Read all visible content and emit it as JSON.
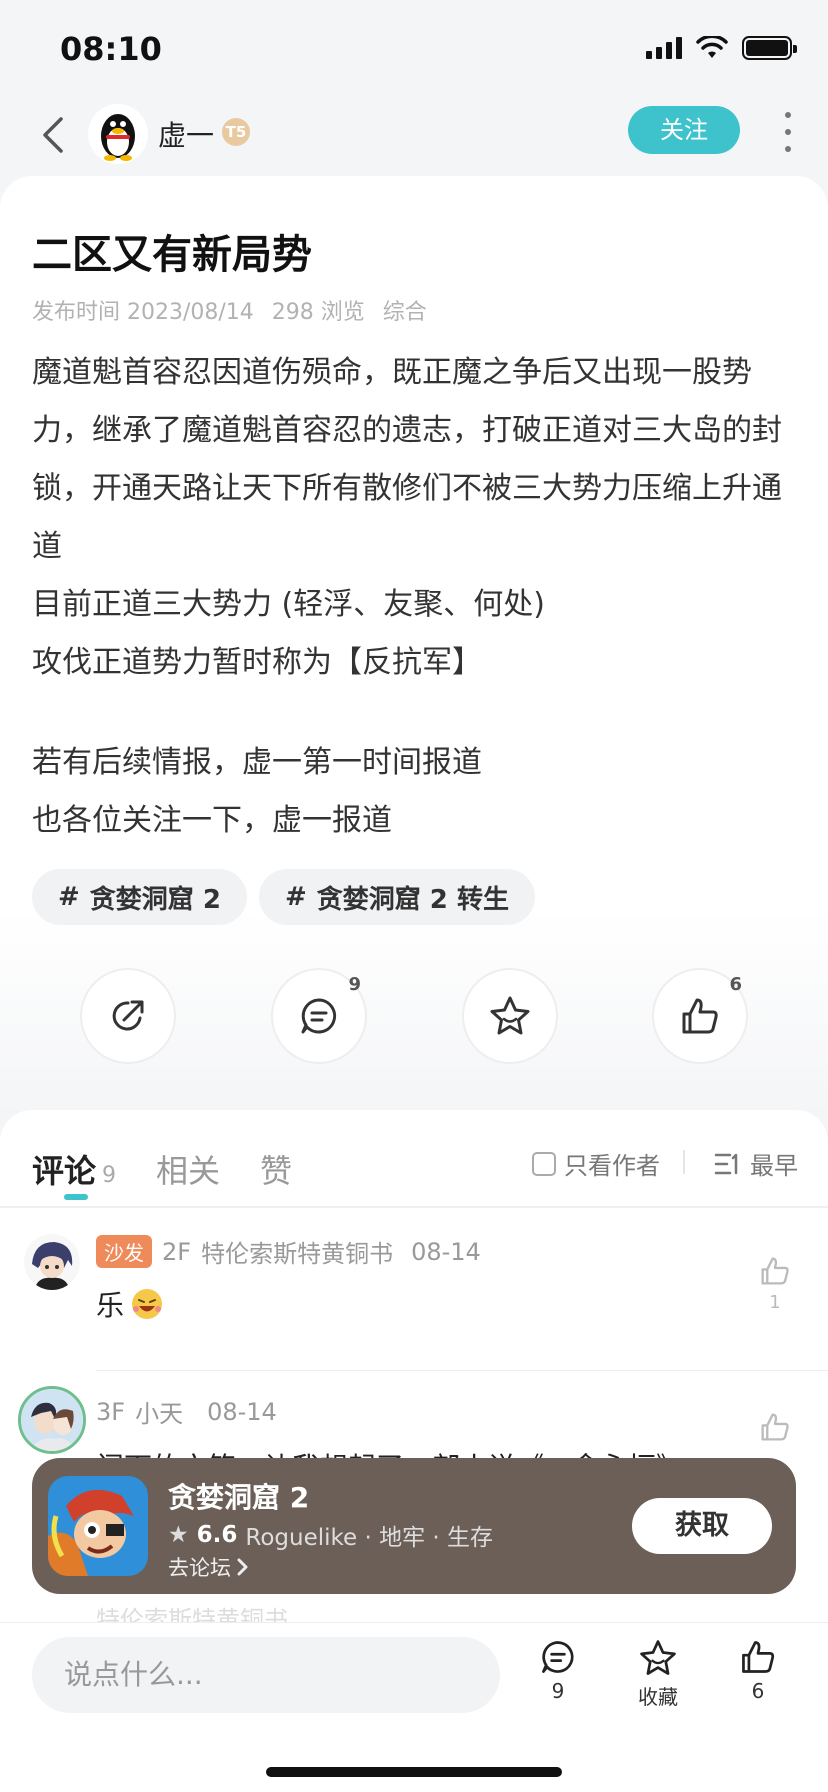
{
  "status_bar": {
    "time": "08:10"
  },
  "nav": {
    "username": "虚一",
    "level": "T5",
    "follow_label": "关注"
  },
  "post": {
    "title": "二区又有新局势",
    "meta": {
      "publish": "发布时间 2023/08/14",
      "views": "298 浏览",
      "category": "综合"
    },
    "paragraphs": [
      "魔道魁首容忍因道伤殒命，既正魔之争后又出现一股势力，继承了魔道魁首容忍的遗志，打破正道对三大岛的封锁，开通天路让天下所有散修们不被三大势力压缩上升通道",
      "目前正道三大势力 (轻浮、友聚、何处)",
      "攻伐正道势力暂时称为【反抗军】",
      "若有后续情报，虚一第一时间报道",
      "也各位关注一下，虚一报道"
    ],
    "tags": [
      "贪婪洞窟 2",
      "贪婪洞窟 2 转生"
    ],
    "actions": {
      "share_icon": "share-icon",
      "comment_count": "9",
      "favorite_icon": "star-icon",
      "like_count": "6"
    }
  },
  "comments": {
    "tabs": [
      {
        "label": "评论",
        "count": "9"
      },
      {
        "label": "相关"
      },
      {
        "label": "赞"
      }
    ],
    "only_author_label": "只看作者",
    "sort_label": "最早",
    "items": [
      {
        "badge": "沙发",
        "floor": "2F",
        "author": "特伦索斯特黄铜书",
        "date": "08-14",
        "text": "乐",
        "likes": "1"
      },
      {
        "floor": "3F",
        "author": "小天",
        "date": "08-14",
        "text": "阁下的文笔，让我想起了一部小说《一念永恒》"
      }
    ],
    "faded_text": "特伦索斯特黄铜书"
  },
  "game_banner": {
    "title": "贪婪洞窟 2",
    "score": "6.6",
    "genres": "Roguelike · 地牢 · 生存",
    "forum_link": "去论坛",
    "get_label": "获取"
  },
  "bottom_bar": {
    "placeholder": "说点什么...",
    "comment_count": "9",
    "favorite_label": "收藏",
    "like_count": "6"
  },
  "colors": {
    "accent": "#3ec3cd",
    "sofa_badge": "#ef8a5a",
    "banner_bg": "#6c5f58"
  }
}
